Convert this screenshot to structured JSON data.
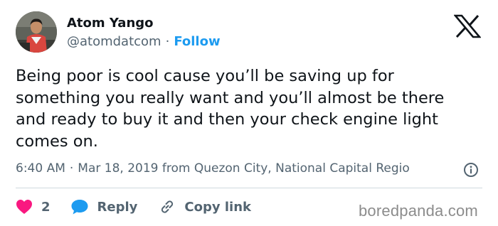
{
  "author": {
    "name": "Atom Yango",
    "handle": "@atomdatcom",
    "separator": "·",
    "follow_label": "Follow"
  },
  "brand": {
    "logo_icon": "x-logo-icon"
  },
  "tweet": {
    "text": "Being poor is cool cause you’ll be saving up for something you really want and you’ll almost be there and ready to buy it and then your check engine light comes on."
  },
  "meta": {
    "time": "6:40 AM",
    "separator": "·",
    "date": "Mar 18, 2019",
    "location": "from Quezon City, National Capital Regio",
    "info_icon": "info-icon"
  },
  "actions": {
    "likes": "2",
    "reply_label": "Reply",
    "copy_label": "Copy link"
  },
  "colors": {
    "like": "#f91880",
    "reply": "#1d9bf0",
    "follow": "#1d9bf0",
    "text": "#0f1419",
    "muted": "#536471"
  },
  "watermark": "boredpanda.com"
}
